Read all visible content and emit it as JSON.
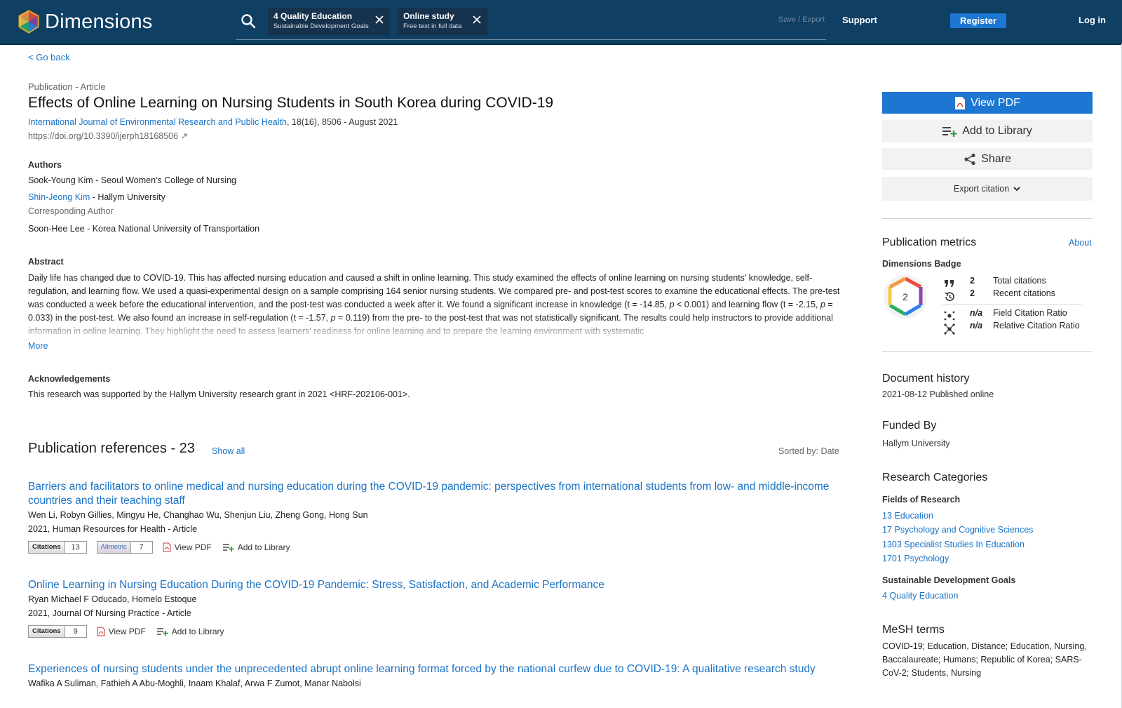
{
  "header": {
    "brand": "Dimensions",
    "chips": [
      {
        "title": "4 Quality Education",
        "subtitle": "Sustainable Development Goals"
      },
      {
        "title": "Online study",
        "subtitle": "Free text in full data"
      }
    ],
    "save_export": "Save / Export",
    "support": "Support",
    "register": "Register",
    "login": "Log in"
  },
  "nav": {
    "go_back": "< Go back"
  },
  "publication": {
    "type": "Publication - Article",
    "title": "Effects of Online Learning on Nursing Students in South Korea during COVID-19",
    "journal": "International Journal of Environmental Research and Public Health",
    "journal_details": ", 18(16), 8506 - August 2021",
    "doi": "https://doi.org/10.3390/ijerph18168506 ↗"
  },
  "authors": {
    "heading": "Authors",
    "a1": "Sook-Young Kim - Seoul Women's College of Nursing",
    "a2_name": "Shin-Jeong Kim",
    "a2_affil": " - Hallym University",
    "a2_role": "Corresponding Author",
    "a3": "Soon-Hee Lee - Korea National University of Transportation"
  },
  "abstract": {
    "heading": "Abstract",
    "p1": "Daily life has changed due to COVID-19. This has affected nursing education and caused a shift in online learning. This study examined the effects of online learning on nursing students' knowledge, self-regulation, and learning flow. We used a quasi-experimental design on a sample comprising 164 senior nursing students. We compared pre- and post-test scores to examine the educational effects. The pre-test was conducted a week before the educational intervention, and the post-test was conducted a week after it. We found a significant increase in knowledge (t = -14.85, ",
    "p_lt": "p",
    "p2": " < 0.001) and learning flow (t = -2.15, ",
    "p_eq1": "p",
    "p3": " = 0.033) in the post-test. We also found an increase in self-regulation (t = -1.57, ",
    "p_eq2": "p",
    "p4": " = 0.119) from the pre- to the post-test that was not statistically significant. The results could help instructors to provide additional information in online learning. They highlight the need to assess learners' readiness for online learning and to prepare the learning environment with systematic",
    "more": "More"
  },
  "acknowledgements": {
    "heading": "Acknowledgements",
    "text": "This research was supported by the Hallym University research grant in 2021 <HRF-202106-001>."
  },
  "references": {
    "title": "Publication references - 23",
    "show_all": "Show all",
    "sorted": "Sorted by: Date",
    "items": [
      {
        "title": "Barriers and facilitators to online medical and nursing education during the COVID-19 pandemic: perspectives from international students from low- and middle-income countries and their teaching staff",
        "authors": "Wen Li, Robyn Gillies, Mingyu He, Changhao Wu, Shenjun Liu, Zheng Gong, Hong Sun",
        "journal": "2021, Human Resources for Health - Article",
        "citations_label": "Citations",
        "citations": "13",
        "altmetric_label": "Altmetric",
        "altmetric": "7",
        "view_pdf": "View PDF",
        "add_library": "Add to Library"
      },
      {
        "title": "Online Learning in Nursing Education During the COVID-19 Pandemic: Stress, Satisfaction, and Academic Performance",
        "authors": "Ryan Michael F Oducado, Homelo Estoque",
        "journal": "2021, Journal Of Nursing Practice - Article",
        "citations_label": "Citations",
        "citations": "9",
        "view_pdf": "View PDF",
        "add_library": "Add to Library"
      },
      {
        "title": "Experiences of nursing students under the unprecedented abrupt online learning format forced by the national curfew due to COVID-19: A qualitative research study",
        "authors": "Wafika A Suliman, Fathieh A Abu-Moghli, Inaam Khalaf, Arwa F Zumot, Manar Nabolsi"
      }
    ]
  },
  "sidebar": {
    "view_pdf": "View PDF",
    "add_library": "Add to Library",
    "share": "Share",
    "export_citation": "Export citation",
    "metrics_title": "Publication metrics",
    "about": "About",
    "badge_label": "Dimensions Badge",
    "badge_value": "2",
    "total_citations": "2",
    "total_citations_label": "Total citations",
    "recent_citations": "2",
    "recent_citations_label": "Recent citations",
    "fcr": "n/a",
    "fcr_label": "Field Citation Ratio",
    "rcr": "n/a",
    "rcr_label": "Relative Citation Ratio",
    "history_title": "Document history",
    "history_text": "2021-08-12 Published online",
    "funded_title": "Funded By",
    "funded_text": "Hallym University",
    "categories_title": "Research Categories",
    "fields_heading": "Fields of Research",
    "fields": [
      "13 Education",
      "17 Psychology and Cognitive Sciences",
      "1303 Specialist Studies In Education",
      "1701 Psychology"
    ],
    "sdg_heading": "Sustainable Development Goals",
    "sdg": "4 Quality Education",
    "mesh_title": "MeSH terms",
    "mesh_text": "COVID-19; Education, Distance; Education, Nursing, Baccalaureate; Humans; Republic of Korea; SARS-CoV-2; Students, Nursing"
  },
  "colors": {
    "header_bg": "#0f3f63",
    "accent": "#1d76d2",
    "link": "#1a73c7"
  }
}
